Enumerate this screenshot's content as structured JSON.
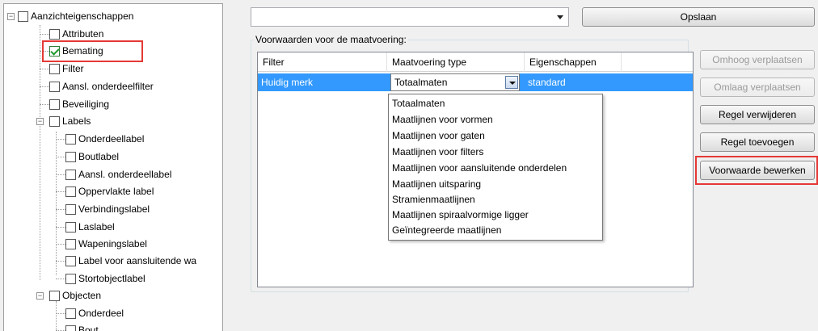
{
  "tree": {
    "root": "Aanzichteigenschappen",
    "items": [
      {
        "label": "Attributen",
        "checked": false
      },
      {
        "label": "Bemating",
        "checked": true
      },
      {
        "label": "Filter",
        "checked": false
      },
      {
        "label": "Aansl. onderdeelfilter",
        "checked": false
      },
      {
        "label": "Beveiliging",
        "checked": false
      },
      {
        "label": "Labels",
        "checked": false
      },
      {
        "label": "Onderdeellabel",
        "checked": false
      },
      {
        "label": "Boutlabel",
        "checked": false
      },
      {
        "label": "Aansl. onderdeellabel",
        "checked": false
      },
      {
        "label": "Oppervlakte label",
        "checked": false
      },
      {
        "label": "Verbindingslabel",
        "checked": false
      },
      {
        "label": "Laslabel",
        "checked": false
      },
      {
        "label": "Wapeningslabel",
        "checked": false
      },
      {
        "label": "Label voor aansluitende wa",
        "checked": false
      },
      {
        "label": "Stortobjectlabel",
        "checked": false
      },
      {
        "label": "Objecten",
        "checked": false
      },
      {
        "label": "Onderdeel",
        "checked": false
      },
      {
        "label": "Bout",
        "checked": false
      }
    ]
  },
  "toolbar": {
    "combo_value": "",
    "save_label": "Opslaan"
  },
  "conditions": {
    "group_title": "Voorwaarden voor de maatvoering:",
    "columns": [
      "Filter",
      "Maatvoering type",
      "Eigenschappen"
    ],
    "row": {
      "filter": "Huidig merk",
      "type": "Totaalmaten",
      "properties": "standard"
    },
    "dropdown_options": [
      "Totaalmaten",
      "Maatlijnen voor vormen",
      "Maatlijnen voor gaten",
      "Maatlijnen voor filters",
      "Maatlijnen voor aansluitende onderdelen",
      "Maatlijnen uitsparing",
      "Stramienmaatlijnen",
      "Maatlijnen spiraalvormige ligger",
      "Geïntegreerde maatlijnen"
    ]
  },
  "buttons": {
    "move_up": "Omhoog verplaatsen",
    "move_down": "Omlaag verplaatsen",
    "delete_rule": "Regel verwijderen",
    "add_rule": "Regel toevoegen",
    "edit_condition": "Voorwaarde bewerken"
  },
  "colors": {
    "selection": "#3399ff",
    "highlight": "#e53935"
  }
}
